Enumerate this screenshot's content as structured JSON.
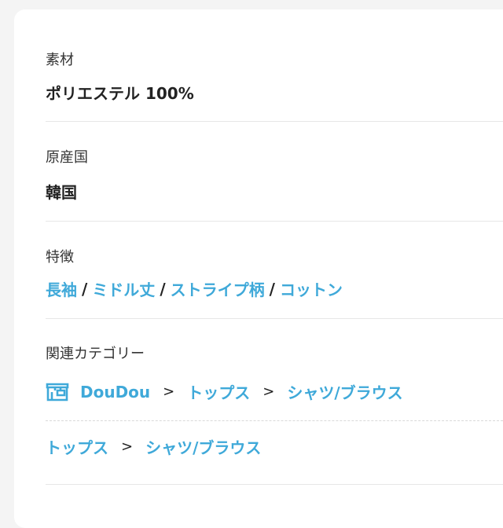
{
  "material": {
    "label": "素材",
    "value": "ポリエステル 100%"
  },
  "origin": {
    "label": "原産国",
    "value": "韓国"
  },
  "features": {
    "label": "特徴",
    "items": [
      "長袖",
      "ミドル丈",
      "ストライプ柄",
      "コットン"
    ],
    "separator": "/"
  },
  "related": {
    "label": "関連カテゴリー",
    "shop_path": [
      "DouDou",
      "トップス",
      "シャツ/ブラウス"
    ],
    "general_path": [
      "トップス",
      "シャツ/ブラウス"
    ],
    "arrow": ">",
    "shop_icon": "shop-icon"
  },
  "colors": {
    "link": "#3fa9d9",
    "text": "#222222",
    "label": "#333333"
  }
}
